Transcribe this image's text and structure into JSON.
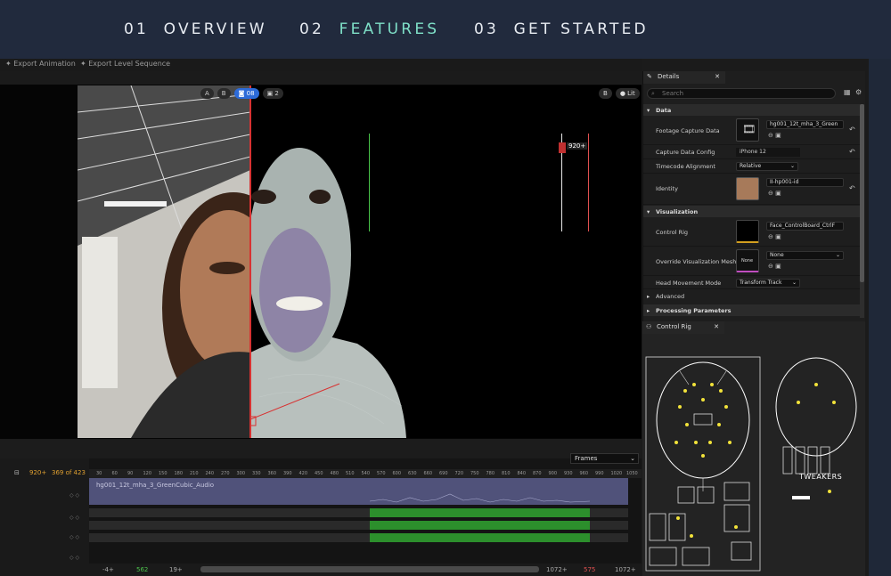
{
  "nav": {
    "items": [
      {
        "num": "01",
        "label": "OVERVIEW",
        "active": false
      },
      {
        "num": "02",
        "label": "FEATURES",
        "active": true
      },
      {
        "num": "03",
        "label": "GET STARTED",
        "active": false
      }
    ],
    "accent": "#7fe0c8",
    "bg": "#212a3d"
  },
  "toolbar": {
    "export_animation": "Export Animation",
    "export_level_sequence": "Export Level Sequence"
  },
  "viewport": {
    "btn_a": "A",
    "btn_b": "B",
    "btn_camera": "08",
    "btn_multi": "2",
    "right_badge": "B",
    "lit_label": "Lit",
    "marker_a": "A",
    "marker_b": "B"
  },
  "timeline": {
    "frames_label": "Frames",
    "current_frame": "920+",
    "counter": "369 of 423",
    "start_frame": "920+",
    "clip_name": "hg001_12t_mha_3_GreenCubic_Audio",
    "ruler_ticks": [
      "30",
      "60",
      "90",
      "120",
      "150",
      "180",
      "210",
      "240",
      "270",
      "300",
      "330",
      "360",
      "390",
      "420",
      "450",
      "480",
      "510",
      "540",
      "570",
      "600",
      "630",
      "660",
      "690",
      "720",
      "750",
      "780",
      "810",
      "840",
      "870",
      "900",
      "930",
      "960",
      "990",
      "1020",
      "1050"
    ],
    "playhead_label": "920+",
    "footer": {
      "left": "-4+",
      "in": "562",
      "in2": "19+",
      "out": "1072+",
      "out_red": "575",
      "end": "1072+"
    }
  },
  "details": {
    "tab": "Details",
    "search_placeholder": "Search",
    "sections": {
      "data": "Data",
      "visualization": "Visualization",
      "advanced": "Advanced",
      "processing": "Processing Parameters"
    },
    "rows": {
      "footage_label": "Footage Capture Data",
      "footage_value": "hg001_12t_mha_3_Green",
      "capture_config_label": "Capture Data Config",
      "capture_config_value": "iPhone 12",
      "timecode_label": "Timecode Alignment",
      "timecode_value": "Relative",
      "identity_label": "Identity",
      "identity_value": "II-hp001-id",
      "control_rig_label": "Control Rig",
      "control_rig_value": "Face_ControlBoard_CtrlF",
      "override_label": "Override Visualization Mesh",
      "override_value": "None",
      "override_thumb": "None",
      "head_label": "Head Movement Mode",
      "head_value": "Transform Track"
    }
  },
  "control_rig": {
    "tab": "Control Rig",
    "tweakers": "TWEAKERS"
  }
}
